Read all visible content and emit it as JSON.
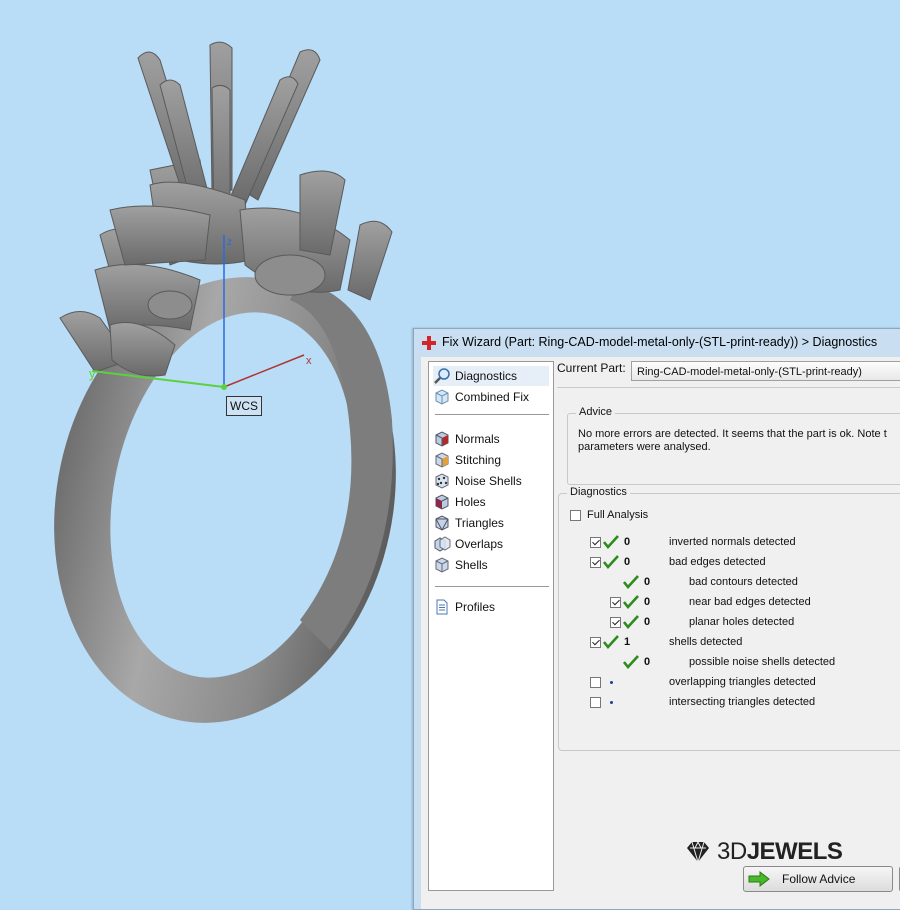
{
  "viewport": {
    "axis_y_label": "y",
    "axis_x_label": "x",
    "axis_z_label": "z",
    "wcs_label": "WCS"
  },
  "dialog": {
    "title": "Fix Wizard (Part: Ring-CAD-model-metal-only-(STL-print-ready)) > Diagnostics",
    "nav": {
      "items": [
        {
          "label": "Diagnostics",
          "icon": "magnifier-icon"
        },
        {
          "label": "Combined Fix",
          "icon": "cube-icon"
        },
        {
          "label": "Normals",
          "icon": "normals-cube-icon"
        },
        {
          "label": "Stitching",
          "icon": "stitching-icon"
        },
        {
          "label": "Noise Shells",
          "icon": "noise-shells-icon"
        },
        {
          "label": "Holes",
          "icon": "holes-icon"
        },
        {
          "label": "Triangles",
          "icon": "triangles-icon"
        },
        {
          "label": "Overlaps",
          "icon": "overlaps-icon"
        },
        {
          "label": "Shells",
          "icon": "shells-icon"
        },
        {
          "label": "Profiles",
          "icon": "document-icon"
        }
      ],
      "selected": "Diagnostics"
    },
    "current_part_label": "Current Part:",
    "current_part_value": "Ring-CAD-model-metal-only-(STL-print-ready)",
    "advice": {
      "title": "Advice",
      "line1": "No more errors are detected. It seems that the part is ok. Note t",
      "line2": "parameters were analysed."
    },
    "diagnostics": {
      "title": "Diagnostics",
      "full_analysis_label": "Full Analysis",
      "full_analysis_checked": false,
      "rows": [
        {
          "checkbox": true,
          "checked": true,
          "tick": true,
          "count": "0",
          "text": "inverted normals detected",
          "indent": 0
        },
        {
          "checkbox": true,
          "checked": true,
          "tick": true,
          "count": "0",
          "text": "bad edges detected",
          "indent": 0
        },
        {
          "checkbox": false,
          "checked": false,
          "tick": true,
          "count": "0",
          "text": "bad contours detected",
          "indent": 1
        },
        {
          "checkbox": true,
          "checked": true,
          "tick": true,
          "count": "0",
          "text": "near bad edges detected",
          "indent": 1
        },
        {
          "checkbox": true,
          "checked": true,
          "tick": true,
          "count": "0",
          "text": "planar holes detected",
          "indent": 1
        },
        {
          "checkbox": true,
          "checked": true,
          "tick": true,
          "count": "1",
          "text": "shells detected",
          "indent": 0
        },
        {
          "checkbox": false,
          "checked": false,
          "tick": true,
          "count": "0",
          "text": "possible noise shells detected",
          "indent": 1
        },
        {
          "checkbox": true,
          "checked": false,
          "tick": false,
          "count": "",
          "text": "overlapping triangles detected",
          "indent": 0
        },
        {
          "checkbox": true,
          "checked": false,
          "tick": false,
          "count": "",
          "text": "intersecting triangles detected",
          "indent": 0
        }
      ]
    },
    "logo": {
      "prefix": "3D",
      "suffix": "JEWELS"
    },
    "follow_advice_label": "Follow Advice",
    "colors": {
      "accent_green": "#2e8b1e",
      "title_red": "#d0252a",
      "background": "#b9dcf7"
    }
  }
}
